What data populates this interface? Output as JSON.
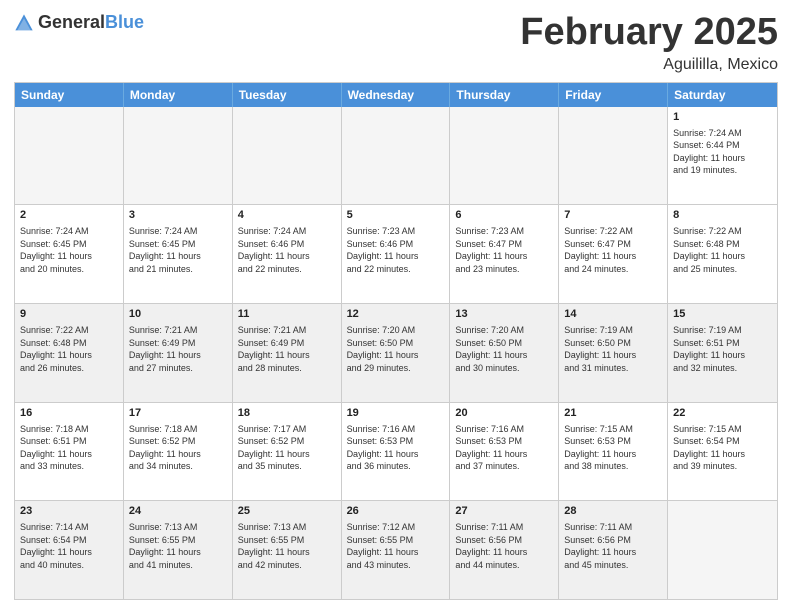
{
  "header": {
    "logo_general": "General",
    "logo_blue": "Blue",
    "month": "February 2025",
    "location": "Aguililla, Mexico"
  },
  "weekdays": [
    "Sunday",
    "Monday",
    "Tuesday",
    "Wednesday",
    "Thursday",
    "Friday",
    "Saturday"
  ],
  "weeks": [
    [
      {
        "day": "",
        "info": "",
        "empty": true
      },
      {
        "day": "",
        "info": "",
        "empty": true
      },
      {
        "day": "",
        "info": "",
        "empty": true
      },
      {
        "day": "",
        "info": "",
        "empty": true
      },
      {
        "day": "",
        "info": "",
        "empty": true
      },
      {
        "day": "",
        "info": "",
        "empty": true
      },
      {
        "day": "1",
        "info": "Sunrise: 7:24 AM\nSunset: 6:44 PM\nDaylight: 11 hours\nand 19 minutes."
      }
    ],
    [
      {
        "day": "2",
        "info": "Sunrise: 7:24 AM\nSunset: 6:45 PM\nDaylight: 11 hours\nand 20 minutes."
      },
      {
        "day": "3",
        "info": "Sunrise: 7:24 AM\nSunset: 6:45 PM\nDaylight: 11 hours\nand 21 minutes."
      },
      {
        "day": "4",
        "info": "Sunrise: 7:24 AM\nSunset: 6:46 PM\nDaylight: 11 hours\nand 22 minutes."
      },
      {
        "day": "5",
        "info": "Sunrise: 7:23 AM\nSunset: 6:46 PM\nDaylight: 11 hours\nand 22 minutes."
      },
      {
        "day": "6",
        "info": "Sunrise: 7:23 AM\nSunset: 6:47 PM\nDaylight: 11 hours\nand 23 minutes."
      },
      {
        "day": "7",
        "info": "Sunrise: 7:22 AM\nSunset: 6:47 PM\nDaylight: 11 hours\nand 24 minutes."
      },
      {
        "day": "8",
        "info": "Sunrise: 7:22 AM\nSunset: 6:48 PM\nDaylight: 11 hours\nand 25 minutes."
      }
    ],
    [
      {
        "day": "9",
        "info": "Sunrise: 7:22 AM\nSunset: 6:48 PM\nDaylight: 11 hours\nand 26 minutes.",
        "shaded": true
      },
      {
        "day": "10",
        "info": "Sunrise: 7:21 AM\nSunset: 6:49 PM\nDaylight: 11 hours\nand 27 minutes.",
        "shaded": true
      },
      {
        "day": "11",
        "info": "Sunrise: 7:21 AM\nSunset: 6:49 PM\nDaylight: 11 hours\nand 28 minutes.",
        "shaded": true
      },
      {
        "day": "12",
        "info": "Sunrise: 7:20 AM\nSunset: 6:50 PM\nDaylight: 11 hours\nand 29 minutes.",
        "shaded": true
      },
      {
        "day": "13",
        "info": "Sunrise: 7:20 AM\nSunset: 6:50 PM\nDaylight: 11 hours\nand 30 minutes.",
        "shaded": true
      },
      {
        "day": "14",
        "info": "Sunrise: 7:19 AM\nSunset: 6:50 PM\nDaylight: 11 hours\nand 31 minutes.",
        "shaded": true
      },
      {
        "day": "15",
        "info": "Sunrise: 7:19 AM\nSunset: 6:51 PM\nDaylight: 11 hours\nand 32 minutes.",
        "shaded": true
      }
    ],
    [
      {
        "day": "16",
        "info": "Sunrise: 7:18 AM\nSunset: 6:51 PM\nDaylight: 11 hours\nand 33 minutes."
      },
      {
        "day": "17",
        "info": "Sunrise: 7:18 AM\nSunset: 6:52 PM\nDaylight: 11 hours\nand 34 minutes."
      },
      {
        "day": "18",
        "info": "Sunrise: 7:17 AM\nSunset: 6:52 PM\nDaylight: 11 hours\nand 35 minutes."
      },
      {
        "day": "19",
        "info": "Sunrise: 7:16 AM\nSunset: 6:53 PM\nDaylight: 11 hours\nand 36 minutes."
      },
      {
        "day": "20",
        "info": "Sunrise: 7:16 AM\nSunset: 6:53 PM\nDaylight: 11 hours\nand 37 minutes."
      },
      {
        "day": "21",
        "info": "Sunrise: 7:15 AM\nSunset: 6:53 PM\nDaylight: 11 hours\nand 38 minutes."
      },
      {
        "day": "22",
        "info": "Sunrise: 7:15 AM\nSunset: 6:54 PM\nDaylight: 11 hours\nand 39 minutes."
      }
    ],
    [
      {
        "day": "23",
        "info": "Sunrise: 7:14 AM\nSunset: 6:54 PM\nDaylight: 11 hours\nand 40 minutes.",
        "shaded": true
      },
      {
        "day": "24",
        "info": "Sunrise: 7:13 AM\nSunset: 6:55 PM\nDaylight: 11 hours\nand 41 minutes.",
        "shaded": true
      },
      {
        "day": "25",
        "info": "Sunrise: 7:13 AM\nSunset: 6:55 PM\nDaylight: 11 hours\nand 42 minutes.",
        "shaded": true
      },
      {
        "day": "26",
        "info": "Sunrise: 7:12 AM\nSunset: 6:55 PM\nDaylight: 11 hours\nand 43 minutes.",
        "shaded": true
      },
      {
        "day": "27",
        "info": "Sunrise: 7:11 AM\nSunset: 6:56 PM\nDaylight: 11 hours\nand 44 minutes.",
        "shaded": true
      },
      {
        "day": "28",
        "info": "Sunrise: 7:11 AM\nSunset: 6:56 PM\nDaylight: 11 hours\nand 45 minutes.",
        "shaded": true
      },
      {
        "day": "",
        "info": "",
        "empty": true,
        "shaded": false
      }
    ]
  ]
}
